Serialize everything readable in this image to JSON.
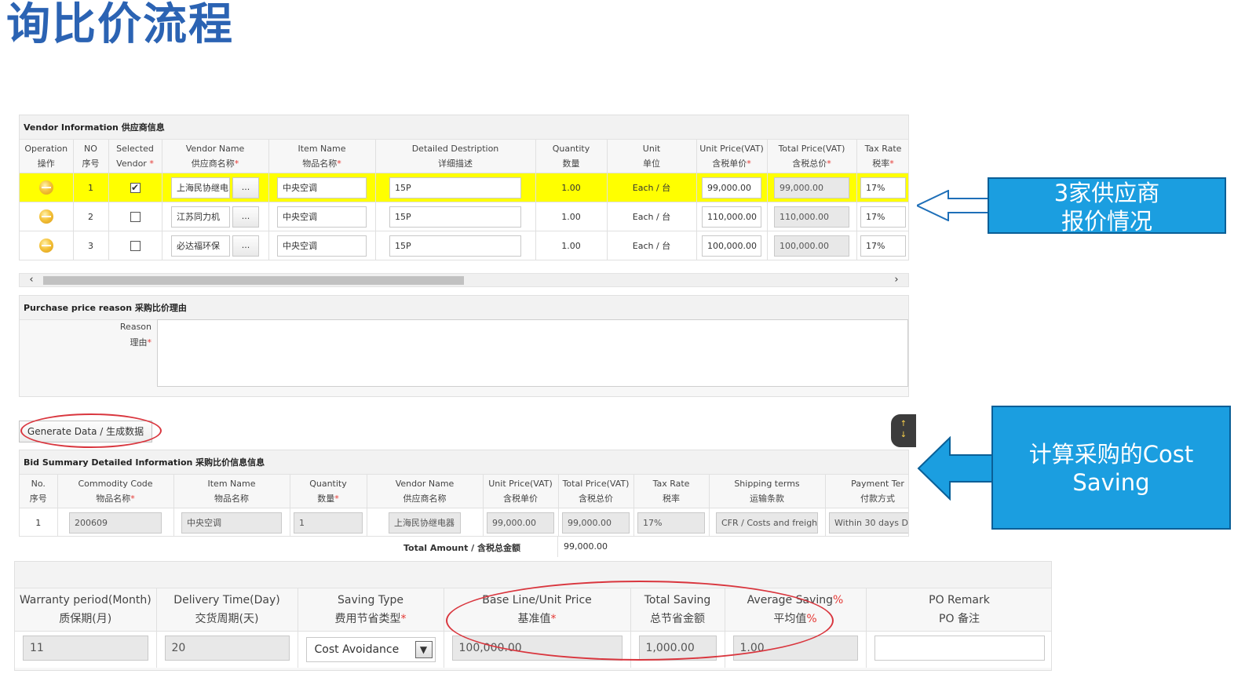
{
  "slide_title": "询比价流程",
  "vendor_panel": {
    "title": "Vendor Information 供应商信息",
    "columns": [
      {
        "en": "Operation",
        "zh": "操作",
        "req": ""
      },
      {
        "en": "NO",
        "zh": "序号",
        "req": ""
      },
      {
        "en": "Selected",
        "zh": "Vendor ",
        "req": "*"
      },
      {
        "en": "Vendor Name",
        "zh": "供应商名称",
        "req": "*"
      },
      {
        "en": "Item Name",
        "zh": "物品名称",
        "req": "*"
      },
      {
        "en": "Detailed Destription",
        "zh": "详细描述",
        "req": ""
      },
      {
        "en": "Quantity",
        "zh": "数量",
        "req": ""
      },
      {
        "en": "Unit",
        "zh": "单位",
        "req": ""
      },
      {
        "en": "Unit Price(VAT)",
        "zh": "含税单价",
        "req": "*"
      },
      {
        "en": "Total Price(VAT)",
        "zh": "含税总价",
        "req": "*"
      },
      {
        "en": "Tax Rate",
        "zh": "税率",
        "req": "*"
      }
    ],
    "rows": [
      {
        "no": "1",
        "checked": "✔",
        "vendor": "上海民协继电",
        "dots": "...",
        "item": "中央空调",
        "desc": "15P",
        "qty": "1.00",
        "unit": "Each / 台",
        "unit_price": "99,000.00",
        "total_price": "99,000.00",
        "tax": "17%"
      },
      {
        "no": "2",
        "checked": "",
        "vendor": "江苏同力机",
        "dots": "...",
        "item": "中央空调",
        "desc": "15P",
        "qty": "1.00",
        "unit": "Each / 台",
        "unit_price": "110,000.00",
        "total_price": "110,000.00",
        "tax": "17%"
      },
      {
        "no": "3",
        "checked": "",
        "vendor": "必达福环保",
        "dots": "...",
        "item": "中央空调",
        "desc": "15P",
        "qty": "1.00",
        "unit": "Each / 台",
        "unit_price": "100,000.00",
        "total_price": "100,000.00",
        "tax": "17%"
      }
    ],
    "scroll_left": "‹",
    "scroll_right": "›"
  },
  "reason_panel": {
    "title": "Purchase price reason 采购比价理由",
    "label_en": "Reason",
    "label_zh": "理由",
    "req": "*"
  },
  "generate_button": "Generate Data / 生成数据",
  "side_button": {
    "up": "↑",
    "down": "↓"
  },
  "bid_panel": {
    "title": "Bid Summary Detailed Information 采购比价信息信息",
    "columns": [
      {
        "en": "No.",
        "zh": "序号",
        "req": ""
      },
      {
        "en": "Commodity Code",
        "zh": "物品名称",
        "req": "*"
      },
      {
        "en": "Item Name",
        "zh": "物品名称",
        "req": ""
      },
      {
        "en": "Quantity",
        "zh": "数量",
        "req": "*"
      },
      {
        "en": "Vendor Name",
        "zh": "供应商名称",
        "req": ""
      },
      {
        "en": "Unit Price(VAT)",
        "zh": "含税单价",
        "req": ""
      },
      {
        "en": "Total Price(VAT)",
        "zh": "含税总价",
        "req": ""
      },
      {
        "en": "Tax Rate",
        "zh": "税率",
        "req": ""
      },
      {
        "en": "Shipping terms",
        "zh": "运输条款",
        "req": ""
      },
      {
        "en": "Payment Ter",
        "zh": "付款方式",
        "req": ""
      }
    ],
    "row": {
      "no": "1",
      "code": "200609",
      "item": "中央空调",
      "qty": "1",
      "vendor": "上海民协继电器",
      "unit_price": "99,000.00",
      "total_price": "99,000.00",
      "tax": "17%",
      "shipping": "CFR / Costs and freight",
      "payment": "Within 30 days D"
    },
    "total_label": "Total Amount / 含税总金额",
    "total_value": "99,000.00"
  },
  "saving_panel": {
    "columns": [
      {
        "en": "Warranty period(Month)",
        "zh": "质保期(月)",
        "req": "",
        "pct": ""
      },
      {
        "en": "Delivery Time(Day)",
        "zh": "交货周期(天)",
        "req": "",
        "pct": ""
      },
      {
        "en": "Saving Type",
        "zh": "费用节省类型",
        "req": "*",
        "pct": ""
      },
      {
        "en": "Base Line/Unit Price",
        "zh": "基准值",
        "req": "*",
        "pct": ""
      },
      {
        "en": "Total Saving",
        "zh": "总节省金额",
        "req": "",
        "pct": ""
      },
      {
        "en": "Average Saving",
        "zh": "平均值",
        "req": "",
        "pct": "%"
      },
      {
        "en": "PO Remark",
        "zh": "PO 备注",
        "req": "",
        "pct": ""
      }
    ],
    "values": {
      "warranty": "11",
      "delivery": "20",
      "saving_type": "Cost Avoidance",
      "baseline": "100,000.00",
      "total_saving": "1,000.00",
      "average": "1.00",
      "remark": ""
    },
    "select_arrow": "▼"
  },
  "callouts": {
    "top_line1": "3家供应商",
    "top_line2": "报价情况",
    "bottom_line1": "计算采购的Cost",
    "bottom_line2": "Saving"
  },
  "colors": {
    "title": "#2b63b3",
    "highlight_row": "#ffff00",
    "callout": "#1b9ee0",
    "ellipse": "#d9363e"
  }
}
